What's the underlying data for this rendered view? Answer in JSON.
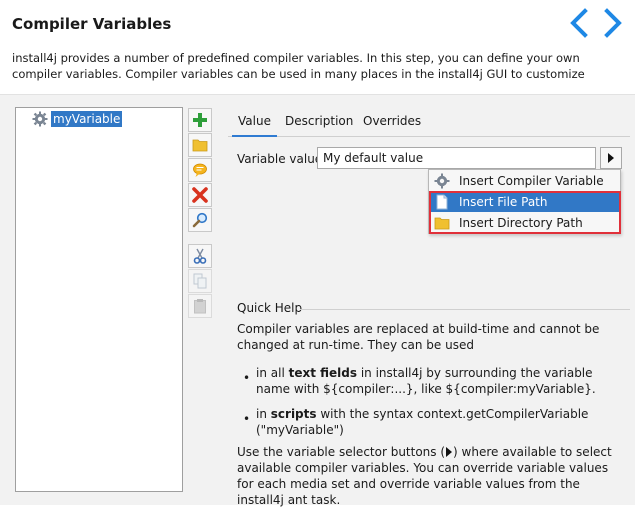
{
  "header": {
    "title": "Compiler Variables",
    "description": "install4j provides a number of predefined compiler variables. In this step, you can define your own compiler variables. Compiler variables can be used in many places in the install4j GUI to customize",
    "nav_back_icon": "chevron-left-icon",
    "nav_forward_icon": "chevron-right-icon",
    "accent": "#1e88e5"
  },
  "tree": {
    "items": [
      {
        "label": "myVariable",
        "icon": "gear-icon",
        "selected": true
      }
    ]
  },
  "toolbar": {
    "buttons": [
      {
        "name": "add-icon",
        "color": "#2e9e3a"
      },
      {
        "name": "folder-icon",
        "color": "#f0c030"
      },
      {
        "name": "comment-icon",
        "color": "#f5a300"
      },
      {
        "name": "delete-icon",
        "color": "#d8321e"
      },
      {
        "name": "search-icon",
        "color": "#2f77c8"
      },
      {
        "name": "cut-icon",
        "color": "#3a6fb8"
      },
      {
        "name": "copy-icon",
        "color": "#9aa8b8"
      },
      {
        "name": "paste-icon",
        "color": "#9a9a9a"
      }
    ]
  },
  "tabs": [
    {
      "label": "Value",
      "active": true
    },
    {
      "label": "Description",
      "active": false
    },
    {
      "label": "Overrides",
      "active": false
    }
  ],
  "value_form": {
    "label": "Variable value:",
    "value": "My default value",
    "selector_icon": "play-arrow-icon"
  },
  "popup_menu": {
    "items": [
      {
        "label": "Insert Compiler Variable",
        "icon": "gear-icon",
        "mnemonic_index": 7,
        "selected": false
      },
      {
        "label": "Insert File Path",
        "icon": "file-icon",
        "selected": true
      },
      {
        "label": "Insert Directory Path",
        "icon": "folder-icon",
        "selected": false
      }
    ],
    "selection_color": "#3178c6",
    "highlight_color": "#e0303a"
  },
  "quick_help": {
    "title": "Quick Help",
    "intro": "Compiler variables are replaced at build-time and cannot be changed at run-time. They can be used",
    "bullets": [
      {
        "prefix": "in all ",
        "bold": "text fields",
        "suffix": " in install4j by surrounding the variable name with ${compiler:...}, like ${compiler:myVariable}."
      },
      {
        "prefix": "in ",
        "bold": "scripts",
        "suffix": " with the syntax context.getCompilerVariable (\"myVariable\")"
      }
    ],
    "outro_before": "Use the variable selector buttons (",
    "outro_after": ") where available to select available compiler variables. You can override variable values for each media set and override variable values from the install4j ant task."
  }
}
